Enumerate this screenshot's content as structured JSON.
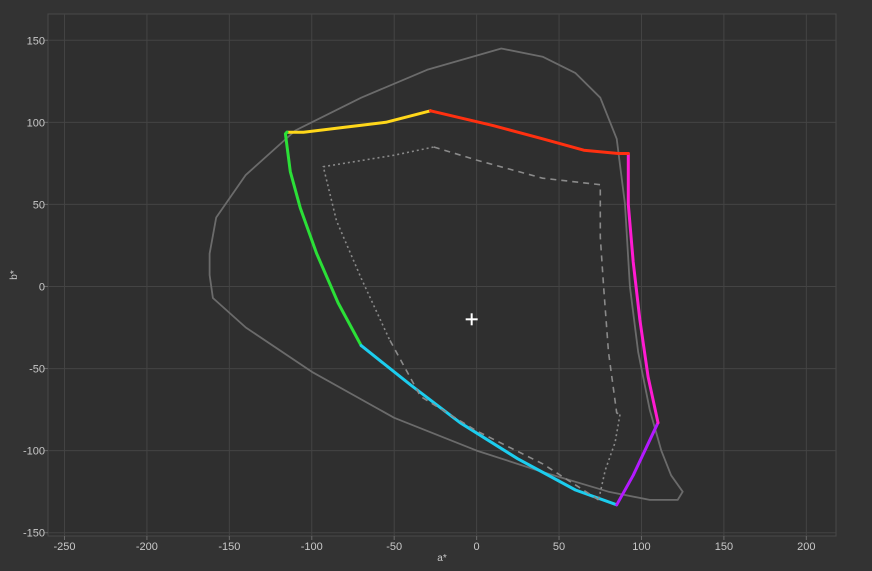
{
  "chart_data": {
    "type": "line",
    "xlabel": "a*",
    "ylabel": "b*",
    "xlim": [
      -260,
      218
    ],
    "ylim": [
      -152,
      166
    ],
    "x_ticks": [
      -250,
      -200,
      -150,
      -100,
      -50,
      0,
      50,
      100,
      150,
      200
    ],
    "y_ticks": [
      -150,
      -100,
      -50,
      0,
      50,
      100,
      150
    ],
    "grid": true,
    "colors": {
      "background": "#333333",
      "plot_background": "#2f2f2f",
      "grid": "#444444",
      "text": "#c8c8c8",
      "outline": "#6b6b6b",
      "dashed": "#8a8a8a"
    },
    "white_point": {
      "x": -3,
      "y": -20
    },
    "series": [
      {
        "style": "solid-gray",
        "closed": true,
        "points": [
          [
            15,
            145
          ],
          [
            40,
            140
          ],
          [
            60,
            130
          ],
          [
            75,
            115
          ],
          [
            85,
            90
          ],
          [
            90,
            50
          ],
          [
            93,
            0
          ],
          [
            98,
            -40
          ],
          [
            105,
            -75
          ],
          [
            112,
            -100
          ],
          [
            118,
            -115
          ],
          [
            125,
            -125
          ],
          [
            122,
            -130
          ],
          [
            105,
            -130
          ],
          [
            80,
            -125
          ],
          [
            40,
            -113
          ],
          [
            0,
            -100
          ],
          [
            -50,
            -80
          ],
          [
            -100,
            -52
          ],
          [
            -140,
            -25
          ],
          [
            -160,
            -7
          ],
          [
            -162,
            7
          ],
          [
            -162,
            20
          ],
          [
            -158,
            42
          ],
          [
            -140,
            68
          ],
          [
            -110,
            95
          ],
          [
            -70,
            115
          ],
          [
            -30,
            132
          ]
        ]
      },
      {
        "style": "gradient",
        "closed": false,
        "segments": [
          {
            "color": "#ffd71a",
            "points": [
              [
                -28,
                107
              ],
              [
                -55,
                100
              ],
              [
                -80,
                97
              ],
              [
                -105,
                94
              ],
              [
                -115,
                94
              ]
            ]
          },
          {
            "color": "#2be037",
            "points": [
              [
                -115,
                94
              ],
              [
                -116,
                93
              ],
              [
                -113,
                70
              ],
              [
                -107,
                48
              ],
              [
                -97,
                20
              ],
              [
                -84,
                -10
              ],
              [
                -70,
                -36
              ]
            ]
          },
          {
            "color": "#1ccdee",
            "points": [
              [
                -70,
                -36
              ],
              [
                -40,
                -60
              ],
              [
                -10,
                -83
              ],
              [
                25,
                -105
              ],
              [
                60,
                -124
              ],
              [
                85,
                -133
              ]
            ]
          },
          {
            "color": "#b31aff",
            "points": [
              [
                85,
                -133
              ],
              [
                95,
                -115
              ],
              [
                110,
                -83
              ]
            ]
          },
          {
            "color": "#ff1ad2",
            "points": [
              [
                110,
                -83
              ],
              [
                104,
                -55
              ],
              [
                99,
                -20
              ],
              [
                95,
                15
              ],
              [
                92,
                50
              ],
              [
                92,
                81
              ]
            ]
          },
          {
            "color": "#ff3010",
            "points": [
              [
                92,
                81
              ],
              [
                86,
                81
              ],
              [
                65,
                83
              ],
              [
                40,
                90
              ],
              [
                10,
                98
              ],
              [
                -28,
                107
              ]
            ]
          }
        ]
      },
      {
        "style": "dashed",
        "closed": false,
        "points": [
          [
            -26,
            85
          ],
          [
            0,
            77
          ],
          [
            40,
            66
          ],
          [
            75,
            62
          ],
          [
            75,
            30
          ],
          [
            77,
            0
          ],
          [
            80,
            -40
          ],
          [
            85,
            -77
          ],
          [
            87,
            -78
          ]
        ]
      },
      {
        "style": "dotted",
        "closed": false,
        "points": [
          [
            87,
            -78
          ],
          [
            84,
            -95
          ],
          [
            78,
            -112
          ],
          [
            74,
            -130
          ]
        ]
      },
      {
        "style": "dashed",
        "closed": false,
        "points": [
          [
            74,
            -130
          ],
          [
            40,
            -108
          ],
          [
            0,
            -88
          ],
          [
            -34,
            -67
          ],
          [
            -53,
            -32
          ]
        ]
      },
      {
        "style": "dotted",
        "closed": false,
        "points": [
          [
            -53,
            -32
          ],
          [
            -70,
            5
          ],
          [
            -85,
            40
          ],
          [
            -93,
            73
          ],
          [
            -50,
            80
          ],
          [
            -26,
            85
          ]
        ]
      }
    ]
  }
}
